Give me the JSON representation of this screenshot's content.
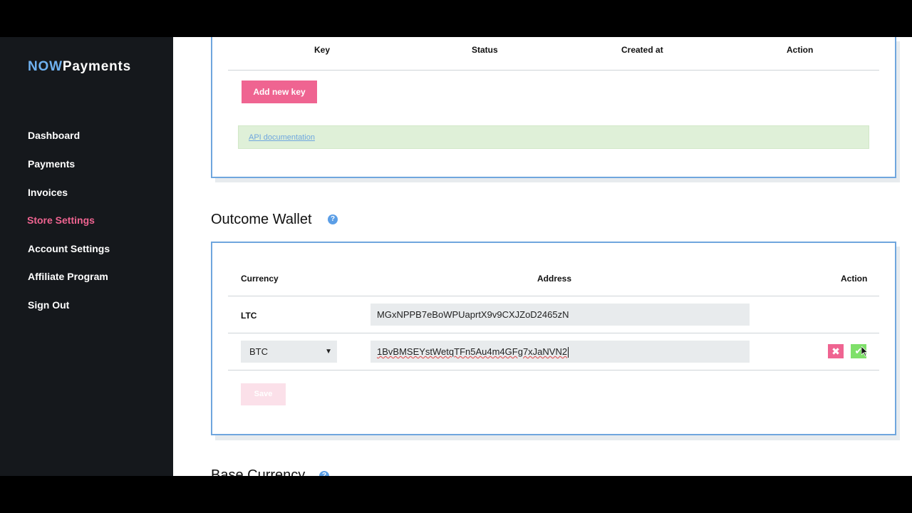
{
  "brand": {
    "prefix": "NOW",
    "suffix": "Payments"
  },
  "sidebar": {
    "items": [
      {
        "label": "Dashboard"
      },
      {
        "label": "Payments"
      },
      {
        "label": "Invoices"
      },
      {
        "label": "Store Settings",
        "active": true
      },
      {
        "label": "Account Settings"
      },
      {
        "label": "Affiliate Program"
      },
      {
        "label": "Sign Out"
      }
    ]
  },
  "api_keys": {
    "columns": [
      "Key",
      "Status",
      "Created at",
      "Action"
    ],
    "add_button": "Add new key",
    "doc_link": "API documentation"
  },
  "outcome_wallet": {
    "title": "Outcome Wallet",
    "columns": [
      "Currency",
      "Address",
      "Action"
    ],
    "rows": [
      {
        "currency": "LTC",
        "address": "MGxNPPB7eBoWPUaprtX9v9CXJZoD2465zN"
      },
      {
        "currency": "BTC",
        "address": "1BvBMSEYstWetqTFn5Au4m4GFg7xJaNVN2"
      }
    ],
    "save_button": "Save"
  },
  "base_currency": {
    "title": "Base Currency"
  },
  "colors": {
    "accent": "#ef6491",
    "brand_blue": "#6fb1f0",
    "card_border": "#6fa6de",
    "success": "#7fe06a"
  },
  "icons": {
    "help": "question-circle-icon",
    "cancel": "times-icon",
    "confirm": "check-icon"
  }
}
